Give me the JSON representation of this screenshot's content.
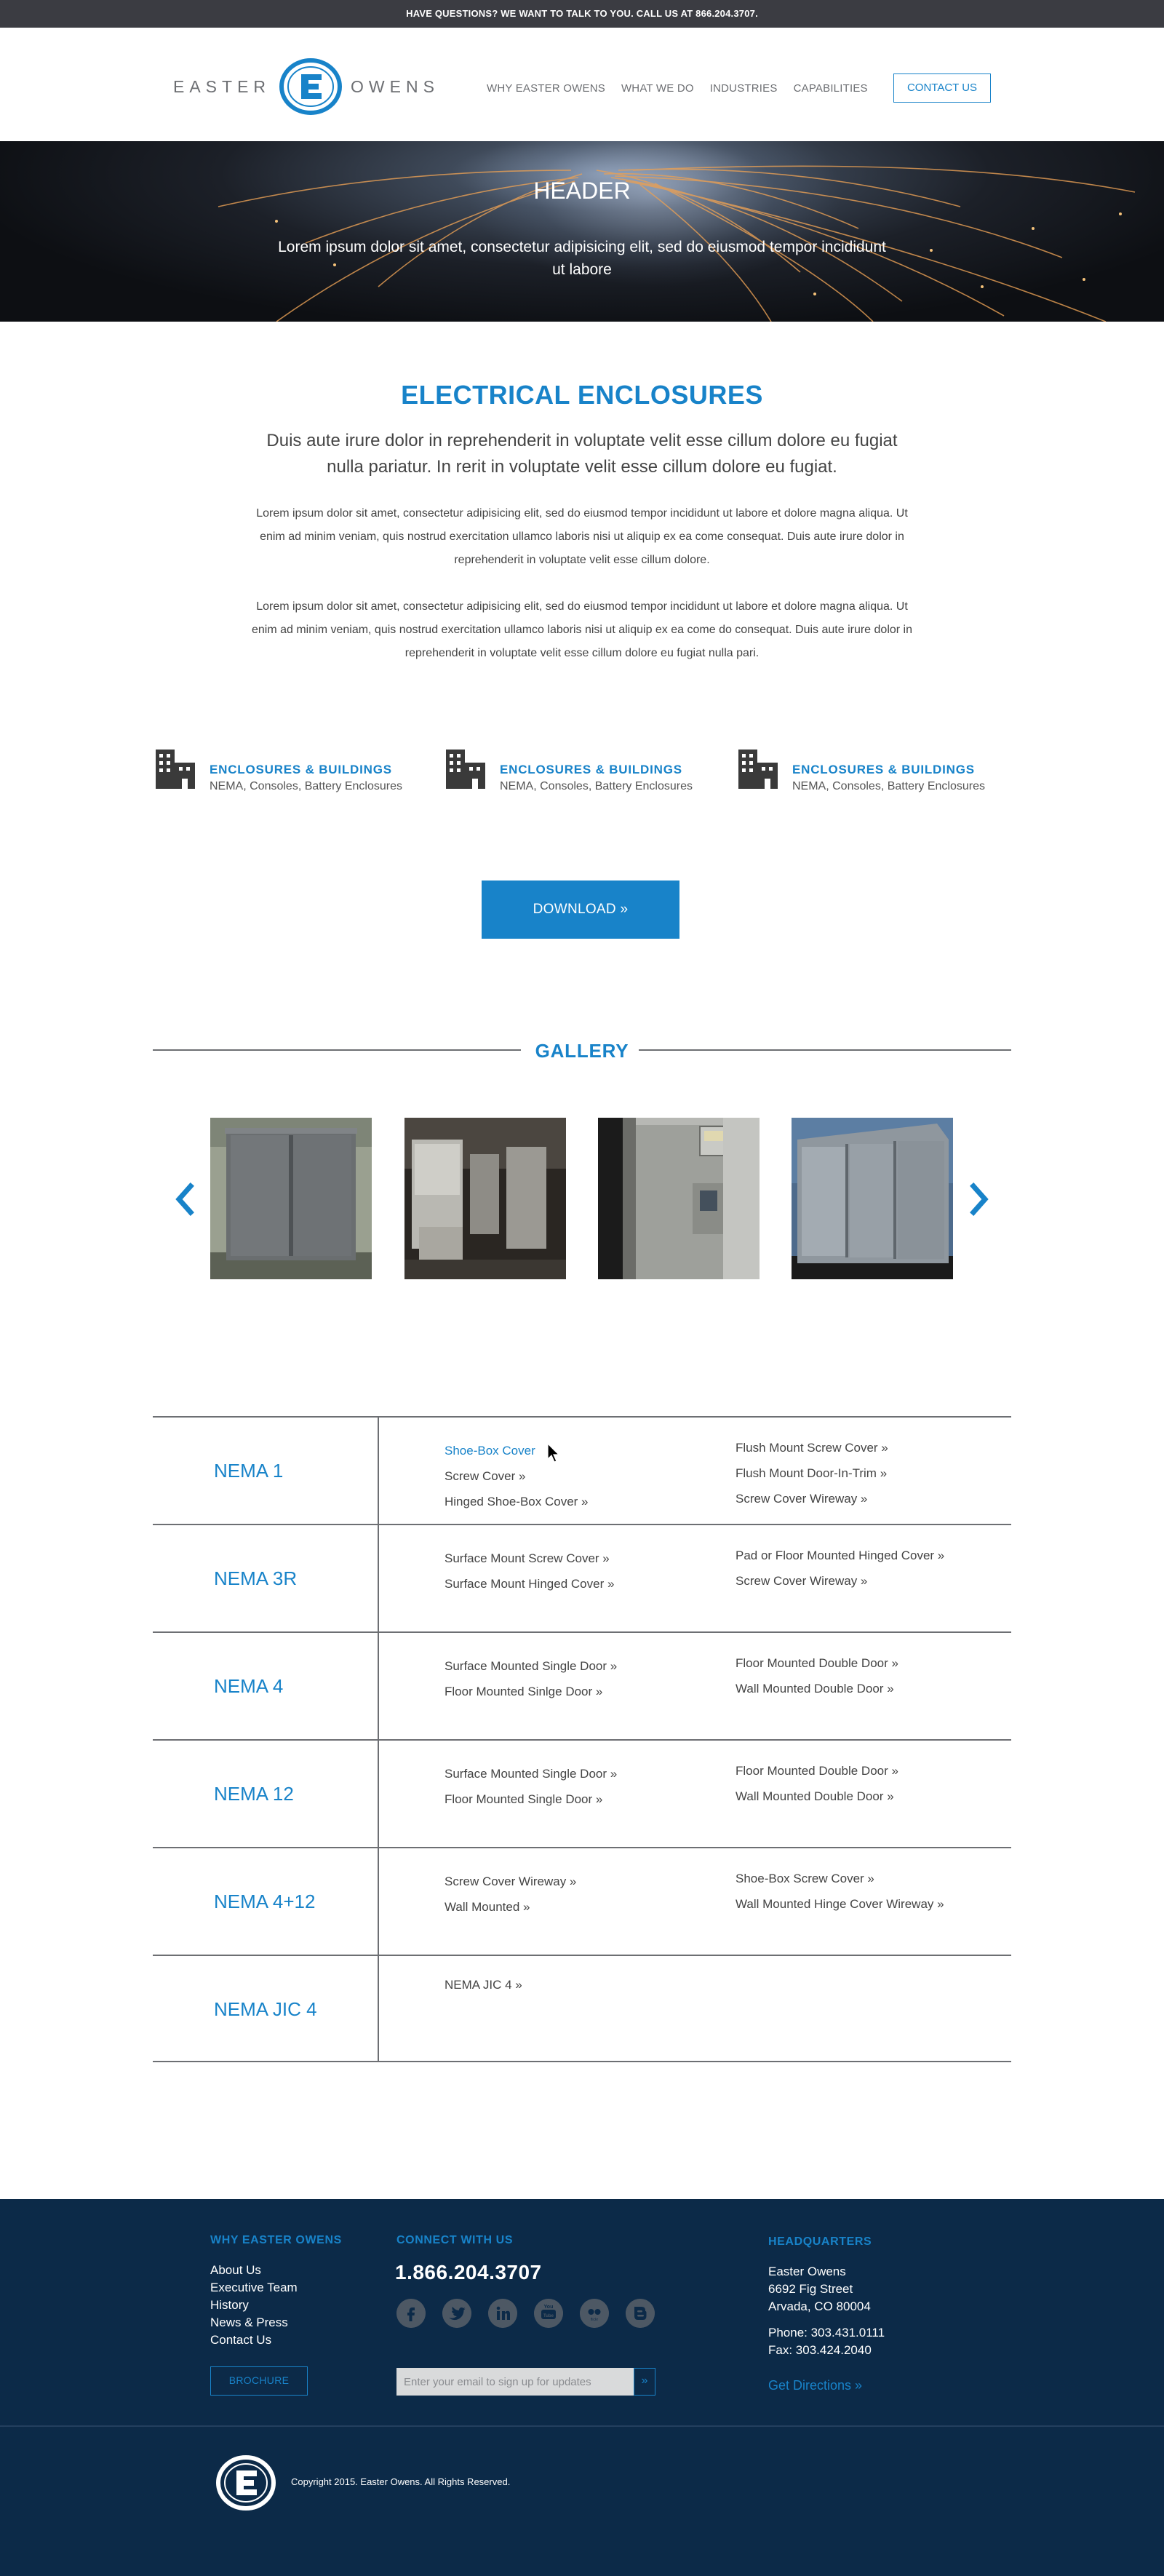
{
  "topbar": {
    "text": "HAVE QUESTIONS? WE WANT TO TALK TO YOU. CALL US AT 866.204.3707."
  },
  "logo": {
    "word_left": "EASTER",
    "word_right": "OWENS",
    "mark_letter": "E"
  },
  "nav": {
    "links": [
      "WHY EASTER OWENS",
      "WHAT WE DO",
      "INDUSTRIES",
      "CAPABILITIES"
    ],
    "contact": "CONTACT US"
  },
  "hero": {
    "title": "HEADER",
    "subtitle": "Lorem ipsum dolor sit amet, consectetur adipisicing elit, sed do eiusmod tempor incididunt ut labore"
  },
  "intro": {
    "title": "ELECTRICAL ENCLOSURES",
    "lead": "Duis aute irure dolor in reprehenderit in voluptate velit esse cillum dolore eu fugiat nulla pariatur. In rerit in voluptate velit esse cillum dolore eu fugiat.",
    "paragraph1": "Lorem ipsum dolor sit amet, consectetur adipisicing elit, sed do eiusmod tempor incididunt ut labore et dolore magna aliqua. Ut enim ad minim veniam, quis nostrud exercitation ullamco laboris nisi ut aliquip ex ea come consequat. Duis aute irure dolor in reprehenderit in voluptate velit esse cillum dolore.",
    "paragraph2": "Lorem ipsum dolor sit amet, consectetur adipisicing elit, sed do eiusmod tempor incididunt ut labore et dolore magna aliqua. Ut enim ad minim veniam, quis nostrud exercitation ullamco laboris nisi ut aliquip ex ea come do consequat. Duis aute irure dolor in reprehenderit in voluptate velit esse cillum dolore eu fugiat nulla pari."
  },
  "features": [
    {
      "title": "ENCLOSURES & BUILDINGS",
      "subtitle": "NEMA, Consoles, Battery Enclosures",
      "icon": "building-icon"
    },
    {
      "title": "ENCLOSURES & BUILDINGS",
      "subtitle": "NEMA, Consoles, Battery Enclosures",
      "icon": "building-icon"
    },
    {
      "title": "ENCLOSURES & BUILDINGS",
      "subtitle": "NEMA, Consoles, Battery Enclosures",
      "icon": "building-icon"
    }
  ],
  "download": {
    "label": "DOWNLOAD  »"
  },
  "gallery": {
    "title": "GALLERY",
    "prev_icon": "chevron-left-icon",
    "next_icon": "chevron-right-icon"
  },
  "nema": [
    {
      "name": "NEMA 1",
      "col1": [
        "Shoe-Box Cover",
        "Screw Cover  »",
        "Hinged Shoe-Box Cover  »"
      ],
      "col2": [
        "Flush Mount Screw Cover  »",
        "Flush Mount Door-In-Trim  »",
        "Screw Cover Wireway  »"
      ]
    },
    {
      "name": "NEMA 3R",
      "col1": [
        "Surface Mount Screw Cover  »",
        "Surface Mount Hinged Cover  »"
      ],
      "col2": [
        "Pad or Floor Mounted Hinged Cover  »",
        "Screw Cover Wireway  »"
      ]
    },
    {
      "name": "NEMA 4",
      "col1": [
        "Surface Mounted Single Door  »",
        "Floor Mounted Sinlge Door  »"
      ],
      "col2": [
        "Floor Mounted Double Door  »",
        "Wall Mounted Double Door  »"
      ]
    },
    {
      "name": "NEMA 12",
      "col1": [
        "Surface Mounted Single Door  »",
        "Floor Mounted Single Door  »"
      ],
      "col2": [
        "Floor Mounted Double Door  »",
        "Wall Mounted Double Door  »"
      ]
    },
    {
      "name": "NEMA 4+12",
      "col1": [
        "Screw Cover Wireway  »",
        "Wall Mounted  »"
      ],
      "col2": [
        "Shoe-Box Screw Cover  »",
        "Wall Mounted Hinge Cover Wireway  »"
      ]
    },
    {
      "name": "NEMA JIC 4",
      "col1": [
        "NEMA JIC 4  »"
      ],
      "col2": []
    }
  ],
  "footer": {
    "why": {
      "heading": "WHY EASTER OWENS",
      "links": [
        "About Us",
        "Executive Team",
        "History",
        "News & Press",
        "Contact Us"
      ],
      "brochure": "BROCHURE"
    },
    "connect": {
      "heading": "CONNECT WITH US",
      "phone": "1.866.204.3707",
      "social": [
        "facebook-icon",
        "twitter-icon",
        "linkedin-icon",
        "youtube-icon",
        "flickr-icon",
        "blogger-icon"
      ],
      "email_placeholder": "Enter your email to sign up for updates",
      "email_button": "»"
    },
    "hq": {
      "heading": "HEADQUARTERS",
      "address": [
        "Easter Owens",
        "6692 Fig Street",
        "Arvada, CO 80004"
      ],
      "phone": "Phone: 303.431.0111",
      "fax": "Fax: 303.424.2040",
      "directions": "Get Directions »"
    },
    "copyright": "Copyright 2015. Easter Owens. All Rights Reserved."
  },
  "colors": {
    "accent": "#1883c9",
    "topbar": "#3b3c42",
    "footer": "#0c2a48",
    "text": "#444444"
  }
}
